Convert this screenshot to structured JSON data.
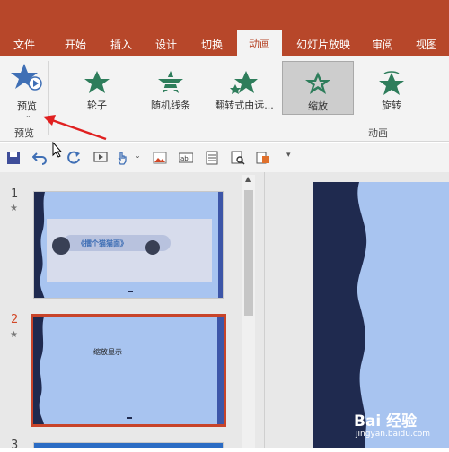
{
  "tabs": [
    {
      "label": "文件"
    },
    {
      "label": "开始"
    },
    {
      "label": "插入"
    },
    {
      "label": "设计"
    },
    {
      "label": "切换"
    },
    {
      "label": "动画"
    },
    {
      "label": "幻灯片放映"
    },
    {
      "label": "审阅"
    },
    {
      "label": "视图"
    }
  ],
  "active_tab": "动画",
  "ribbon": {
    "preview": {
      "label": "预览",
      "group_label": "预览"
    },
    "animations": [
      {
        "label": "轮子",
        "icon": "wheel-star-icon"
      },
      {
        "label": "随机线条",
        "icon": "random-bars-star-icon"
      },
      {
        "label": "翻转式由远...",
        "icon": "grow-turn-star-icon"
      },
      {
        "label": "缩放",
        "icon": "zoom-star-icon",
        "selected": true
      },
      {
        "label": "旋转",
        "icon": "swivel-star-icon"
      }
    ],
    "animation_group_label": "动画"
  },
  "thumbnails": [
    {
      "number": "1",
      "banner_text": "《擂个猫猫面》"
    },
    {
      "number": "2",
      "title": "缩放显示"
    },
    {
      "number": "3"
    }
  ],
  "colors": {
    "accent": "#b7472a",
    "slide_bg": "#a8c4f0",
    "slide_dark": "#1f2a4f",
    "star": "#2e7d5b"
  },
  "watermark": {
    "text": "Bai 经验",
    "sub": "jingyan.baidu.com"
  }
}
